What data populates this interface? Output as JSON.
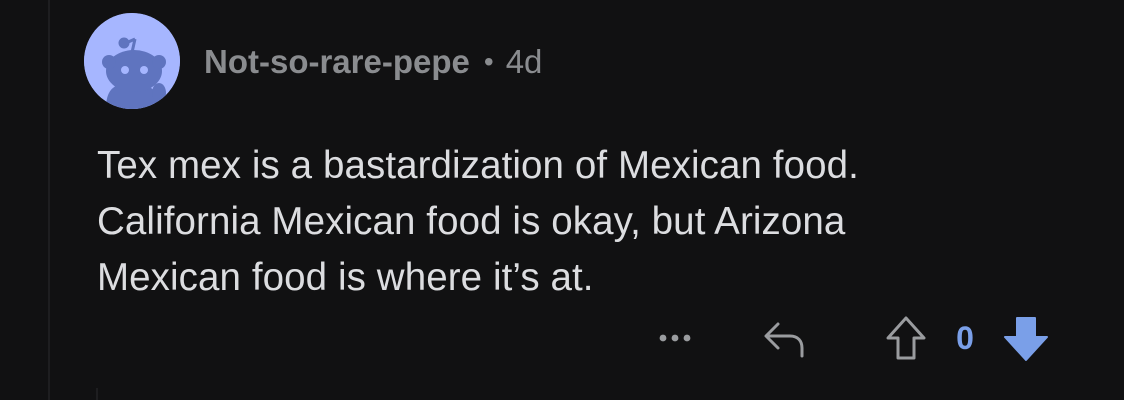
{
  "comment": {
    "username": "Not-so-rare-pepe",
    "separator": "•",
    "age": "4d",
    "body_lines": [
      "Tex mex is a bastardization of Mexican food.",
      "California Mexican food is okay, but Arizona",
      "Mexican food is where it’s at."
    ],
    "score": "0",
    "vote_state": "downvoted"
  },
  "icons": {
    "avatar": "snoo-avatar-icon",
    "more": "more-options-icon",
    "reply": "reply-icon",
    "upvote": "upvote-arrow-icon",
    "downvote": "downvote-arrow-icon"
  },
  "colors": {
    "background": "#111112",
    "avatar_background": "#a6b6ff",
    "meta_text": "#8a8c8f",
    "body_text": "#dcdde0",
    "downvote_accent": "#7a9fe8"
  }
}
